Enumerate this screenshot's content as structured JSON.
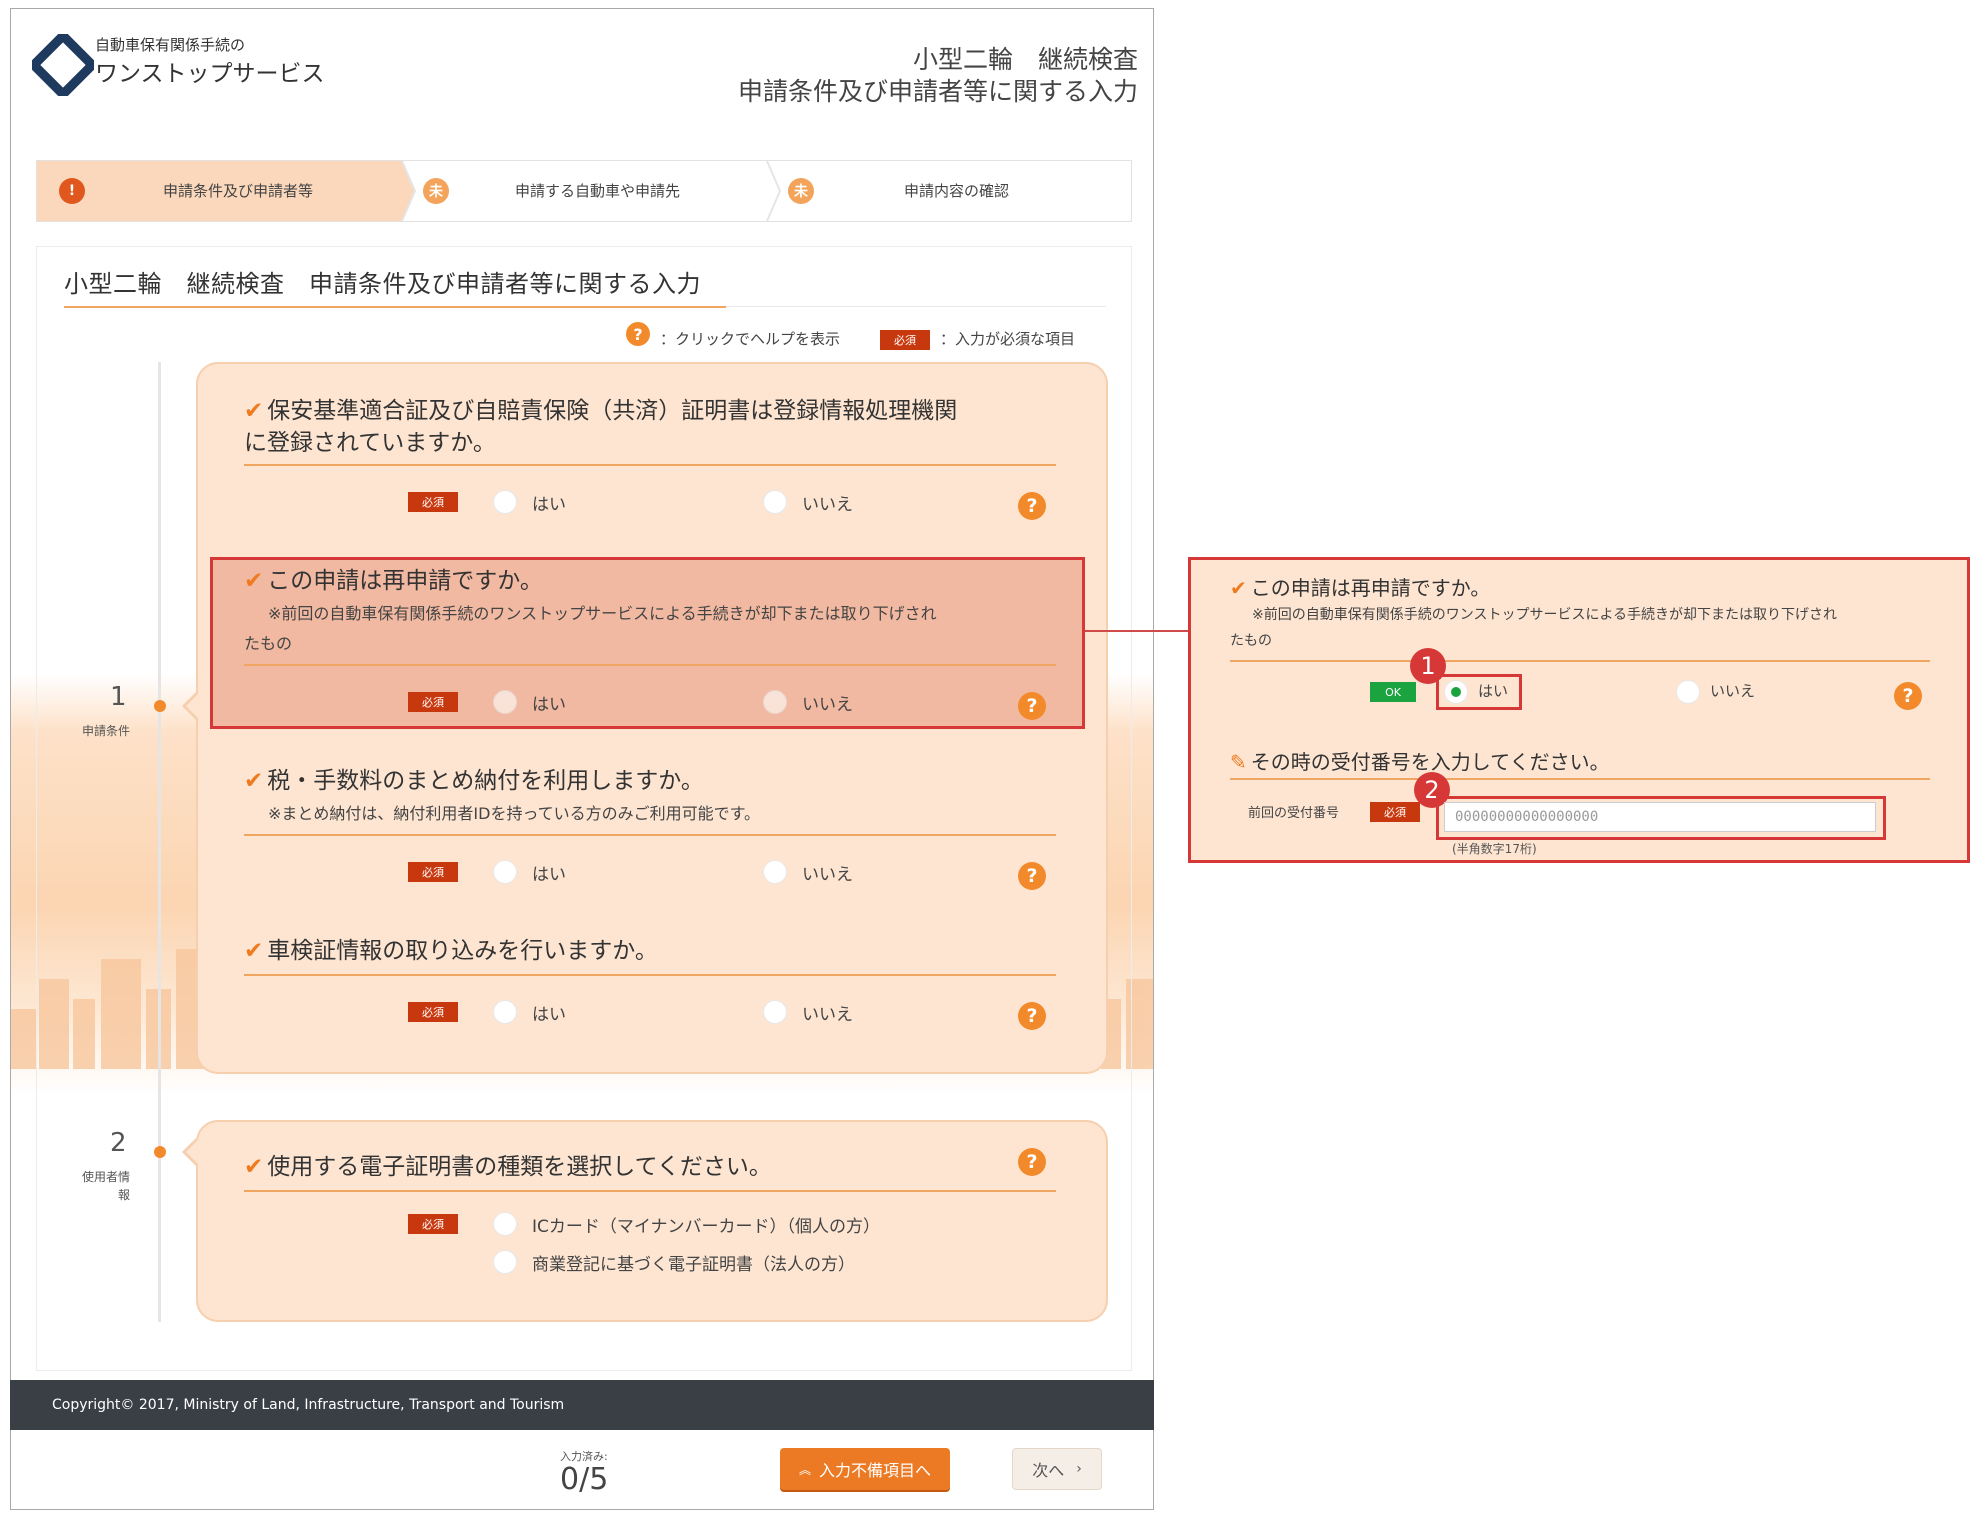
{
  "header": {
    "org_line1": "自動車保有関係手続の",
    "org_line2": "ワンストップサービス",
    "title_line1": "小型二輪　継続検査",
    "title_line2": "申請条件及び申請者等に関する入力"
  },
  "steps": [
    {
      "icon": "!",
      "label": "申請条件及び申請者等",
      "status": "current"
    },
    {
      "icon": "未",
      "label": "申請する自動車や申請先",
      "status": "pending"
    },
    {
      "icon": "未",
      "label": "申請内容の確認",
      "status": "pending"
    }
  ],
  "page_title": "小型二輪　継続検査　申請条件及び申請者等に関する入力",
  "legend": {
    "help_icon": "?",
    "help_text": "：クリックでヘルプを表示",
    "required_badge": "必須",
    "required_text": "：入力が必須な項目"
  },
  "timeline": [
    {
      "number": "1",
      "label": "申請条件"
    },
    {
      "number": "2",
      "label_line1": "使用者情",
      "label_line2": "報"
    }
  ],
  "required": "必須",
  "yes": "はい",
  "no": "いいえ",
  "questions": [
    {
      "title_line1": "保安基準適合証及び自賠責保険（共済）証明書は登録情報処理機関",
      "title_line2": "に登録されていますか。"
    },
    {
      "title": "この申請は再申請ですか。",
      "note_line1": "※前回の自動車保有関係手続のワンストップサービスによる手続きが却下または取り下げされ",
      "note_line2": "たもの"
    },
    {
      "title": "税・手数料のまとめ納付を利用しますか。",
      "note": "※まとめ納付は、納付利用者IDを持っている方のみご利用可能です。"
    },
    {
      "title": "車検証情報の取り込みを行いますか。"
    }
  ],
  "section2": {
    "title": "使用する電子証明書の種類を選択してください。",
    "options": [
      "ICカード（マイナンバーカード）（個人の方）",
      "商業登記に基づく電子証明書（法人の方）"
    ]
  },
  "footer": {
    "copyright": "Copyright© 2017, Ministry of Land, Infrastructure, Transport and Tourism",
    "count_label": "入力済み:",
    "count_value": "0/5",
    "incomplete_button": "入力不備項目へ",
    "next_button": "次へ"
  },
  "callout": {
    "title": "この申請は再申請ですか。",
    "note_line1": "※前回の自動車保有関係手続のワンストップサービスによる手続きが却下または取り下げされ",
    "note_line2": "たもの",
    "ok_badge": "OK",
    "selected": "はい",
    "badge1": "1",
    "badge2": "2",
    "receipt_title": "その時の受付番号を入力してください。",
    "receipt_label": "前回の受付番号",
    "receipt_value": "00000000000000000",
    "receipt_hint": "(半角数字17桁)"
  },
  "colors": {
    "accent": "#f28a2c",
    "required": "#c8380e",
    "ok": "#1aa33f",
    "highlight": "#d63838"
  }
}
